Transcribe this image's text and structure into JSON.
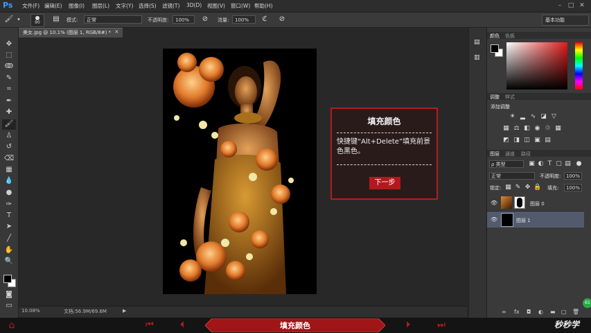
{
  "app": {
    "logo": "Ps"
  },
  "menu": [
    "文件(F)",
    "编辑(E)",
    "图像(I)",
    "图层(L)",
    "文字(Y)",
    "选择(S)",
    "滤镜(T)",
    "3D(D)",
    "视图(V)",
    "窗口(W)",
    "帮助(H)"
  ],
  "window_controls": {
    "minimize": "–",
    "maximize": "□",
    "close": "✕"
  },
  "options": {
    "brush_size": "90",
    "mode_label": "模式:",
    "mode_value": "正常",
    "opacity_label": "不透明度:",
    "opacity_value": "100%",
    "flow_label": "流量:",
    "flow_value": "100%",
    "workspace": "基本功能"
  },
  "document": {
    "tab_label": "美女.jpg @ 10.1% (图层 1, RGB/8#) *",
    "close": "×",
    "zoom": "10.08%",
    "doc_size": "文档:56.9M/69.6M"
  },
  "dialog": {
    "title": "填充颜色",
    "body": "快捷键“Alt+Delete”填充前景色黑色。",
    "button": "下一步"
  },
  "panels": {
    "color_tabs": [
      "颜色",
      "色板"
    ],
    "adjust_tabs": [
      "调整",
      "样式"
    ],
    "adjust_title": "添加调整",
    "layers_tabs": [
      "图层",
      "通道",
      "路径"
    ],
    "kind_filter": "ρ 类型",
    "blend_mode": "正常",
    "opacity_label": "不透明度:",
    "opacity_value": "100%",
    "lock_label": "锁定:",
    "fill_label": "填充:",
    "fill_value": "100%",
    "layers": [
      {
        "name": "图层 0",
        "selected": false
      },
      {
        "name": "图层 1",
        "selected": true
      }
    ]
  },
  "nav": {
    "title": "填充颜色",
    "brand": "秒秒学",
    "badge": "61"
  },
  "colors": {
    "accent_red": "#b71c1c",
    "dialog_border": "#b31d1d",
    "selected_layer": "#525a6e"
  }
}
